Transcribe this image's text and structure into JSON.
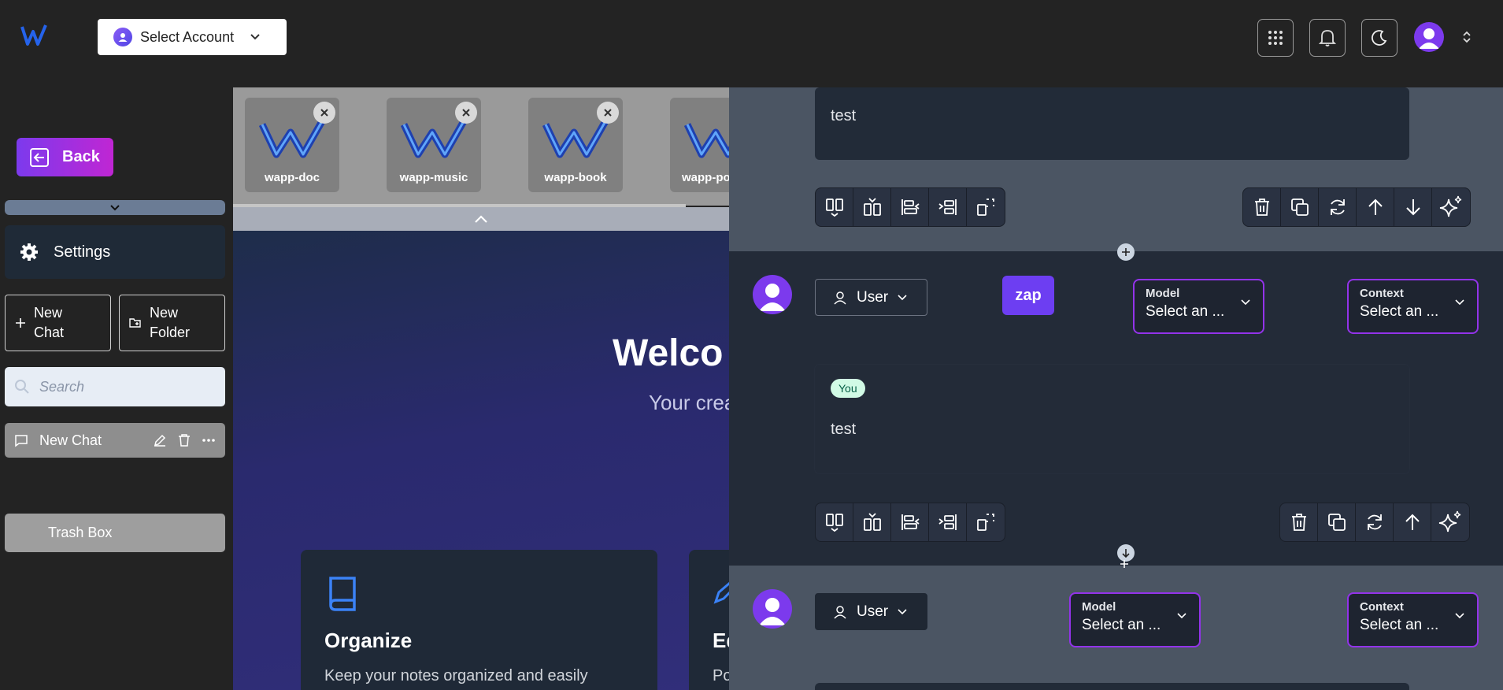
{
  "header": {
    "account_label": "Select Account"
  },
  "sidebar": {
    "back_label": "Back",
    "settings_label": "Settings",
    "new_chat_label": "New Chat",
    "new_folder_label": "New Folder",
    "search_placeholder": "Search",
    "chat_items": [
      "New Chat"
    ],
    "trash_label": "Trash Box"
  },
  "apps": [
    {
      "name": "wapp-doc"
    },
    {
      "name": "wapp-music"
    },
    {
      "name": "wapp-book"
    },
    {
      "name": "wapp-po"
    }
  ],
  "welcome": {
    "title": "Welco",
    "subtitle": "Your crea",
    "card1_title": "Organize",
    "card1_text": "Keep your notes organized and easily",
    "card2_title": "Ed",
    "card2_text": "Po"
  },
  "panel": {
    "msg1_text": "test",
    "msg2_badge": "You",
    "msg2_text": "test",
    "role_label": "User",
    "zap_label": "zap",
    "model_title": "Model",
    "model_value": "Select an ...",
    "context_title": "Context",
    "context_value": "Select an ..."
  },
  "colors": {
    "accent": "#7c3aed",
    "select_border": "#9333ea"
  }
}
